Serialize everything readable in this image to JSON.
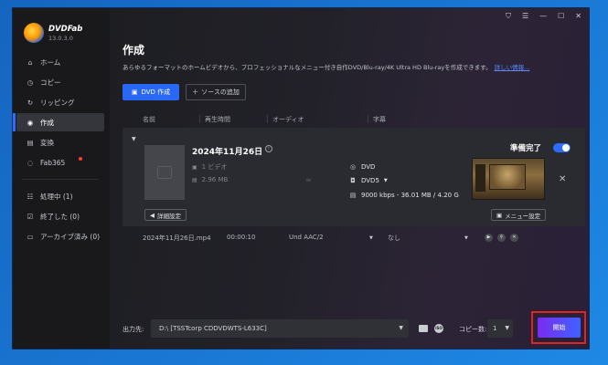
{
  "app": {
    "brand_name": "DVDFab",
    "version": "13.0.3.0"
  },
  "window_controls": [
    "shirt-icon",
    "menu-icon",
    "minimize-icon",
    "maximize-icon",
    "close-icon"
  ],
  "sidebar": {
    "items": [
      {
        "label": "ホーム",
        "icon": "home-icon"
      },
      {
        "label": "コピー",
        "icon": "copy-icon"
      },
      {
        "label": "リッピング",
        "icon": "rip-icon"
      },
      {
        "label": "作成",
        "icon": "create-icon",
        "active": true
      },
      {
        "label": "変換",
        "icon": "convert-icon"
      },
      {
        "label": "Fab365",
        "icon": "fab365-icon",
        "badge": "red-dot"
      }
    ],
    "tasks": [
      {
        "label": "処理中 (1)",
        "icon": "processing-icon"
      },
      {
        "label": "終了した (0)",
        "icon": "finished-icon"
      },
      {
        "label": "アーカイブ済み (0)",
        "icon": "archive-icon"
      }
    ]
  },
  "main": {
    "title": "作成",
    "subtitle": "あらゆるフォーマットのホームビデオから、プロフェッショナルなメニュー付き自作DVD/Blu-ray/4K Ultra HD Blu-rayを作成できます。",
    "more_link": "詳しい情報...",
    "primary_button": "DVD 作成",
    "add_source_button": "ソースの追加",
    "columns": [
      "名前",
      "再生時間",
      "オーディオ",
      "字幕"
    ]
  },
  "task": {
    "title": "2024年11月26日",
    "video_count": "1 ビデオ",
    "size": "2.96 MB",
    "output_format": "DVD",
    "disc_type": "DVD5",
    "bitrate_info": "9000 kbps - 36.01 MB / 4.20 G",
    "status": "準備完了",
    "toggle_on": true,
    "detail_button": "詳細設定",
    "menu_button": "メニュー設定"
  },
  "file_row": {
    "filename": "2024年11月26日.mp4",
    "duration": "00:00:10",
    "audio": "Und  AAC/2",
    "subtitle": "なし"
  },
  "bottom": {
    "output_label": "出力先:",
    "output_path": "D:\\ [TSSTcorp CDDVDWTS-L633C]",
    "copies_label": "コピー数:",
    "copies_value": "1",
    "start_button": "開始"
  },
  "colors": {
    "accent": "#2968f5",
    "highlight": "#e02424",
    "background": "#1976d2"
  }
}
